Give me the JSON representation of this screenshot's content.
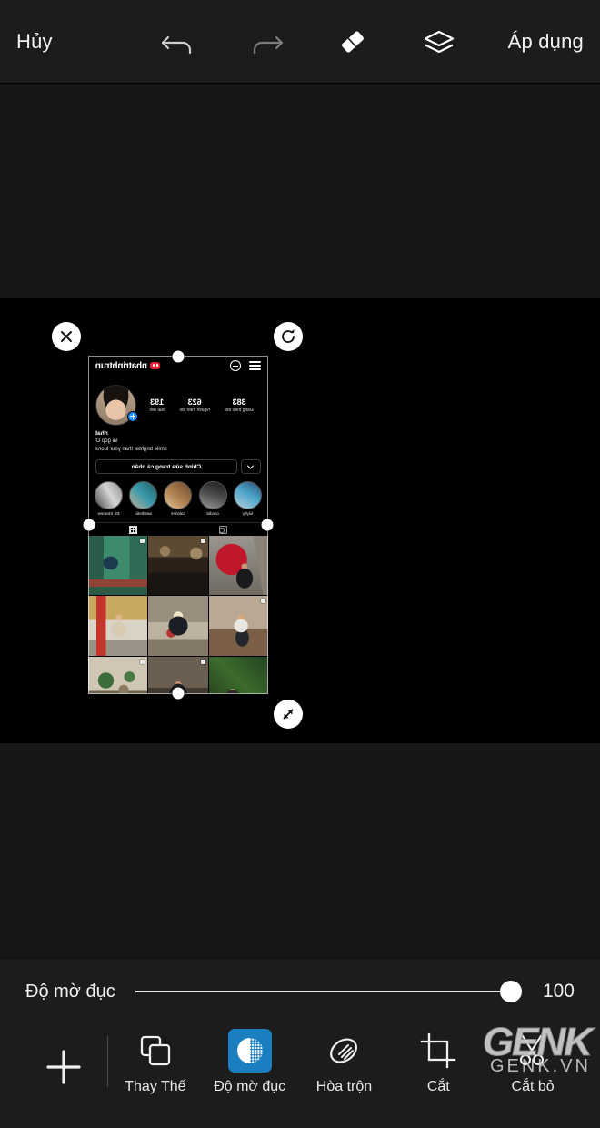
{
  "topbar": {
    "cancel_label": "Hủy",
    "apply_label": "Áp dụng",
    "icons": [
      "undo-icon",
      "redo-icon",
      "eraser-icon",
      "layers-icon"
    ]
  },
  "canvas": {
    "background_color": "#000000",
    "layer": {
      "mirrored": true,
      "ig_header": {
        "menu_icon": "hamburger-icon",
        "add_icon": "plus-circle-icon",
        "username": "nhatrinhtrun"
      },
      "stats": [
        {
          "value": "383",
          "label": "Đang theo dõi"
        },
        {
          "value": "623",
          "label": "Người theo dõi"
        },
        {
          "value": "193",
          "label": "Bài viết"
        }
      ],
      "avatar_badge": "add-story-icon",
      "bio": {
        "name": "nhat",
        "line1": "lại góp Ơ",
        "line2": "smile brighter than your luons"
      },
      "edit_button_label": "Chỉnh sửa trang cá nhân",
      "dropdown_icon": "chevron-down-icon",
      "highlights": [
        {
          "label": "lulyby"
        },
        {
          "label": "candid"
        },
        {
          "label": "calories"
        },
        {
          "label": "aesthetic"
        },
        {
          "label": "Đà Stranew"
        }
      ],
      "tabs": [
        {
          "icon": "tagged-photos-icon"
        },
        {
          "icon": "grid-icon"
        }
      ],
      "grid_rows": 3,
      "grid_cols": 3
    },
    "controls": {
      "close_icon": "close-x-icon",
      "rotate_icon": "rotate-icon",
      "resize_icon": "resize-diagonal-icon"
    }
  },
  "bottom": {
    "slider": {
      "label": "Độ mờ đục",
      "value": "100",
      "min": 0,
      "max": 100
    },
    "tools": [
      {
        "label": "",
        "icon": "plus-icon",
        "active": false
      },
      {
        "label": "Thay Thế",
        "icon": "replace-layers-icon",
        "active": false
      },
      {
        "label": "Độ mờ đục",
        "icon": "opacity-icon",
        "active": true
      },
      {
        "label": "Hòa trộn",
        "icon": "blend-icon",
        "active": false
      },
      {
        "label": "Cắt",
        "icon": "crop-icon",
        "active": false
      },
      {
        "label": "Cắt bỏ",
        "icon": "scissors-icon",
        "active": false
      }
    ],
    "accent_color": "#1a7fc1"
  },
  "watermark": {
    "line1": "GENK",
    "line2": "GENK.VN"
  }
}
